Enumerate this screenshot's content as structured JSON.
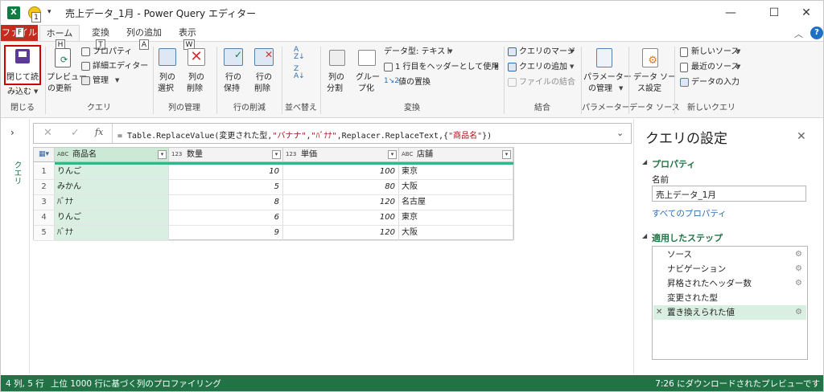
{
  "window": {
    "title": "売上データ_1月 - Power Query エディター",
    "keytips": [
      "1",
      "F",
      "H",
      "T",
      "A",
      "W"
    ]
  },
  "tabs": [
    {
      "label": "ファイル"
    },
    {
      "label": "ホーム"
    },
    {
      "label": "変換"
    },
    {
      "label": "列の追加"
    },
    {
      "label": "表示"
    }
  ],
  "ribbon": {
    "close": {
      "line1": "閉じて読",
      "line2": "み込む",
      "group": "閉じる"
    },
    "query": {
      "preview_line1": "プレビュー",
      "preview_line2": "の更新",
      "properties": "プロパティ",
      "advanced_editor": "詳細エディター",
      "manage": "管理",
      "group": "クエリ"
    },
    "columns": {
      "select_line1": "列の",
      "select_line2": "選択",
      "remove_line1": "列の",
      "remove_line2": "削除",
      "group": "列の管理"
    },
    "rows": {
      "keep_line1": "行の",
      "keep_line2": "保持",
      "remove_line1": "行の",
      "remove_line2": "削除",
      "group": "行の削減"
    },
    "sort": {
      "group": "並べ替え"
    },
    "transform": {
      "split_line1": "列の",
      "split_line2": "分割",
      "group_line1": "グルー",
      "group_line2": "プ化",
      "datatype": "データ型: テキスト",
      "first_row_header": "1 行目をヘッダーとして使用",
      "replace_values": "値の置換",
      "group": "変換"
    },
    "combine": {
      "merge": "クエリのマージ",
      "append": "クエリの追加",
      "combine_files": "ファイルの結合",
      "group": "結合"
    },
    "parameters": {
      "line1": "パラメーター",
      "line2": "の管理",
      "group": "パラメーター"
    },
    "datasource": {
      "line1": "データ ソー",
      "line2": "ス設定",
      "group": "データ ソース"
    },
    "newquery": {
      "new_source": "新しいソース",
      "recent_source": "最近のソース",
      "enter_data": "データの入力",
      "group": "新しいクエリ"
    }
  },
  "nav": {
    "queries_label": "クエリ"
  },
  "formula": {
    "prefix": "= Table.ReplaceValue(変更された型,",
    "arg1": "\"バナナ\"",
    "comma1": ",",
    "arg2": "\"ﾊﾞﾅﾅ\"",
    "mid": ",Replacer.ReplaceText,{",
    "arg3": "\"商品名\"",
    "suffix": "})"
  },
  "table": {
    "columns": [
      {
        "type": "ABC",
        "name": "商品名"
      },
      {
        "type": "123",
        "name": "数量"
      },
      {
        "type": "123",
        "name": "単価"
      },
      {
        "type": "ABC",
        "name": "店舗"
      }
    ],
    "rows": [
      {
        "n": "1",
        "product": "りんご",
        "qty": "10",
        "price": "100",
        "store": "東京"
      },
      {
        "n": "2",
        "product": "みかん",
        "qty": "5",
        "price": "80",
        "store": "大阪"
      },
      {
        "n": "3",
        "product": "ﾊﾞﾅﾅ",
        "qty": "8",
        "price": "120",
        "store": "名古屋"
      },
      {
        "n": "4",
        "product": "りんご",
        "qty": "6",
        "price": "100",
        "store": "東京"
      },
      {
        "n": "5",
        "product": "ﾊﾞﾅﾅ",
        "qty": "9",
        "price": "120",
        "store": "大阪"
      }
    ]
  },
  "settings": {
    "title": "クエリの設定",
    "properties_header": "プロパティ",
    "name_label": "名前",
    "name_value": "売上データ_1月",
    "all_properties": "すべてのプロパティ",
    "steps_header": "適用したステップ",
    "steps": [
      {
        "label": "ソース",
        "gear": true
      },
      {
        "label": "ナビゲーション",
        "gear": true
      },
      {
        "label": "昇格されたヘッダー数",
        "gear": true
      },
      {
        "label": "変更された型",
        "gear": false
      },
      {
        "label": "置き換えられた値",
        "gear": true,
        "selected": true
      }
    ]
  },
  "status": {
    "summary": "4 列, 5 行",
    "profiling": "上位 1000 行に基づく列のプロファイリング",
    "preview_time": "7:26 にダウンロードされたプレビューです"
  },
  "colors": {
    "accent": "#217346",
    "file_tab": "#c42b1c",
    "highlight": "#d8efe1",
    "selected_col_bar": "#38b48b"
  }
}
